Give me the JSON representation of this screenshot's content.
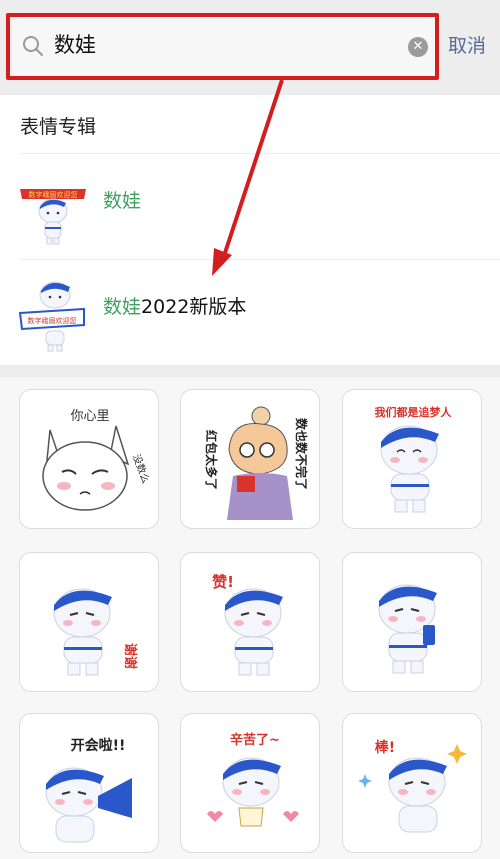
{
  "search": {
    "query": "数娃",
    "cancel_label": "取消"
  },
  "results": {
    "section_title": "表情专辑",
    "albums": [
      {
        "highlight": "数娃",
        "rest": ""
      },
      {
        "highlight": "数娃",
        "rest": "2022新版本"
      }
    ]
  },
  "thumbs": {
    "banner_1": "数字峨眉欢迎您",
    "banner_2": "数字峨眉欢迎您"
  },
  "stickers": [
    {
      "name": "cat",
      "caption": "你心里",
      "caption2": "没数么"
    },
    {
      "name": "girl-counting",
      "caption": "红包太多了",
      "caption2": "数也数不完了"
    },
    {
      "name": "dream-chaser",
      "caption": "我们都是追梦人",
      "caption2": ""
    },
    {
      "name": "thanks",
      "caption": "谢谢",
      "caption2": ""
    },
    {
      "name": "like",
      "caption": "赞!",
      "caption2": ""
    },
    {
      "name": "phone",
      "caption": "",
      "caption2": ""
    },
    {
      "name": "meeting",
      "caption": "开会啦!!",
      "caption2": ""
    },
    {
      "name": "hard-work",
      "caption": "辛苦了~",
      "caption2": ""
    },
    {
      "name": "great",
      "caption": "棒!",
      "caption2": ""
    }
  ],
  "colors": {
    "accent_green": "#3f9f5f",
    "cancel_blue": "#576b95",
    "annotation_red": "#d11f1f",
    "mascot_blue": "#2a57c9"
  }
}
